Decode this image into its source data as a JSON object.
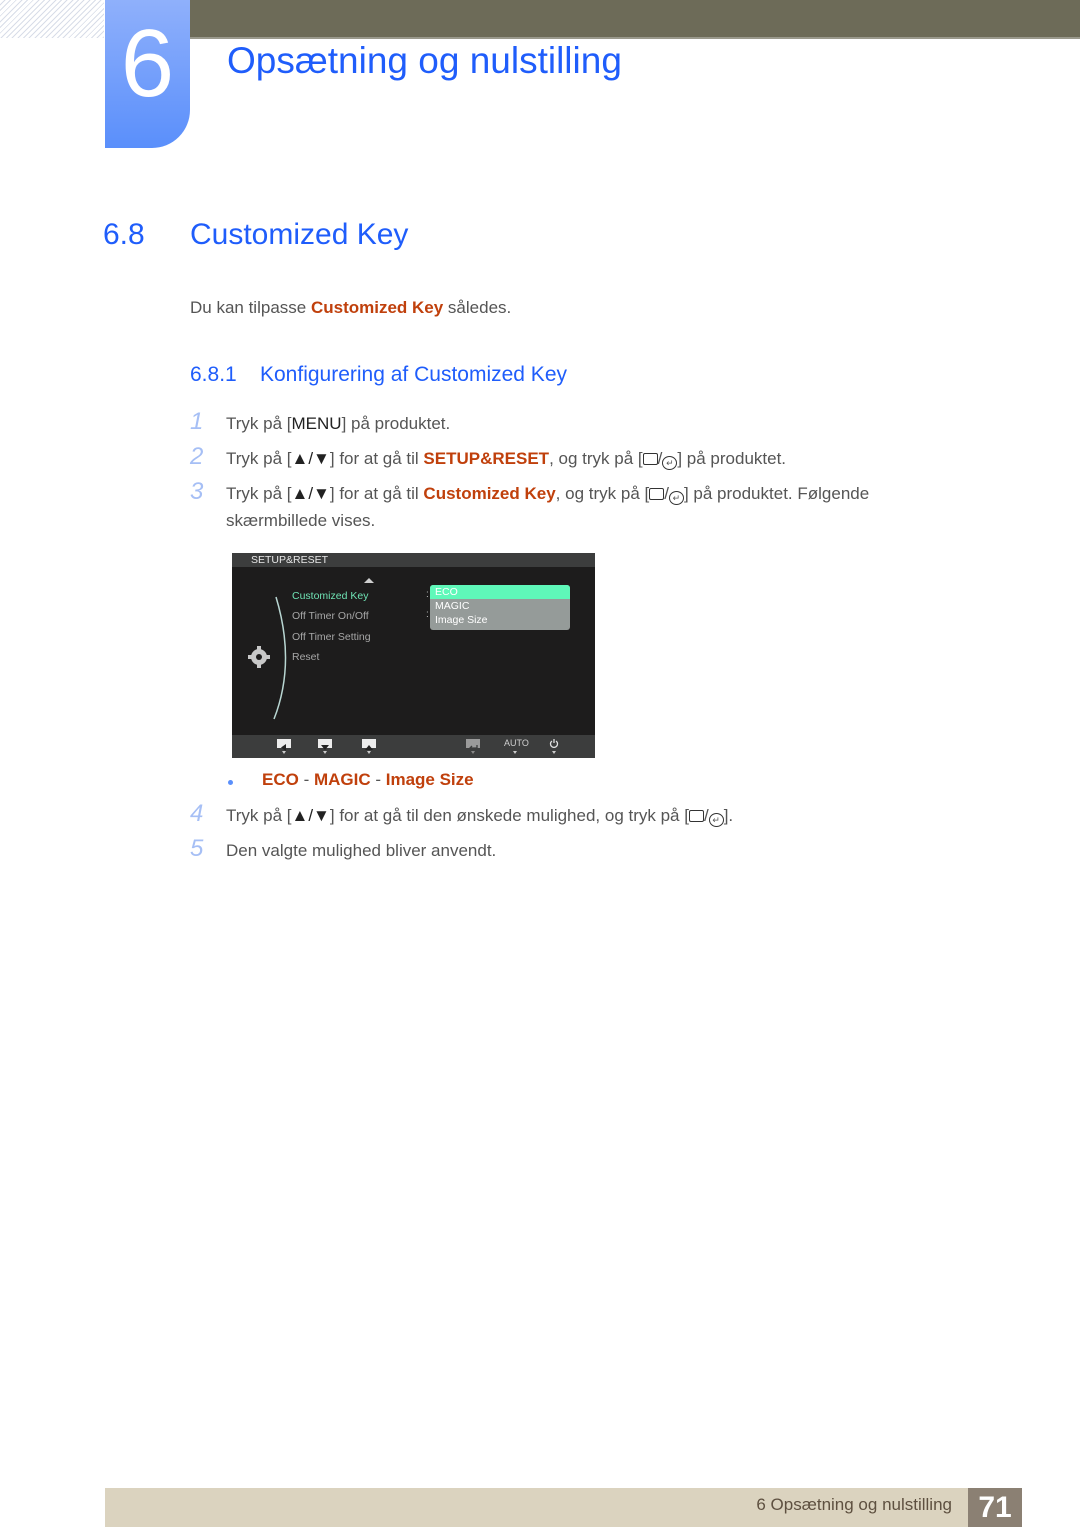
{
  "header": {
    "chapter_number": "6",
    "chapter_title": "Opsætning og nulstilling"
  },
  "section": {
    "number": "6.8",
    "title": "Customized Key"
  },
  "intro": {
    "before": "Du kan tilpasse ",
    "highlight": "Customized Key",
    "after": " således."
  },
  "subsection": {
    "number": "6.8.1",
    "title": "Konfigurering af Customized Key"
  },
  "steps": [
    {
      "num": "1",
      "parts": [
        "Tryk på [",
        "MENU",
        "] på produktet."
      ]
    },
    {
      "num": "2",
      "parts": [
        "Tryk på [",
        "▲/▼",
        "] for at gå til ",
        "SETUP&RESET",
        ", og tryk på [",
        "] på produktet."
      ]
    },
    {
      "num": "3",
      "parts": [
        "Tryk på [",
        "▲/▼",
        "] for at gå til ",
        "Customized Key",
        ", og tryk på [",
        "] på produktet. Følgende skærmbillede vises."
      ]
    },
    {
      "num": "4",
      "parts": [
        "Tryk på [",
        "▲/▼",
        "] for at gå til den ønskede mulighed, og tryk på [",
        "]."
      ]
    },
    {
      "num": "5",
      "parts": [
        "Den valgte mulighed bliver anvendt."
      ]
    }
  ],
  "osd": {
    "title": "SETUP&RESET",
    "menu_items": [
      "Customized Key",
      "Off Timer On/Off",
      "Off Timer Setting",
      "Reset"
    ],
    "active_item": "Customized Key",
    "dropdown_options": [
      "ECO",
      "MAGIC",
      "Image Size"
    ],
    "selected_option": "ECO",
    "footer_buttons": [
      "left-arrow",
      "down-arrow",
      "up-arrow",
      "enter",
      "AUTO",
      "power"
    ],
    "auto_label": "AUTO",
    "colors": {
      "active_text": "#6fe3b4",
      "selected_bg": "#5ff8b9"
    }
  },
  "options_bullet": {
    "items": [
      "ECO",
      "MAGIC",
      "Image Size"
    ],
    "separator": " - "
  },
  "footer": {
    "text": "6 Opsætning og nulstilling",
    "page": "71"
  },
  "colors": {
    "accent_blue": "#1f5dfb",
    "highlight_orange": "#c0400c",
    "topbar": "#6d6b58",
    "footer_bg": "#dbd3bf",
    "page_box": "#8b8073"
  }
}
